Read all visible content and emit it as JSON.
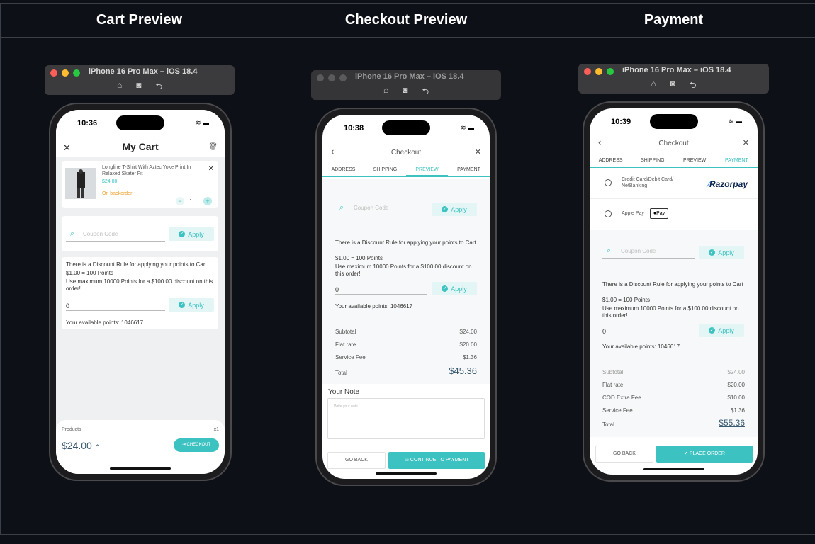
{
  "columns": [
    {
      "title": "Cart Preview"
    },
    {
      "title": "Checkout Preview"
    },
    {
      "title": "Payment"
    }
  ],
  "simulator": {
    "title": "iPhone 16 Pro Max – iOS 18.4",
    "icons": [
      "⌂",
      "◙",
      "⮌"
    ]
  },
  "cart": {
    "time": "10:36",
    "status_icons": "···· ≋ ▬",
    "title": "My Cart",
    "item": {
      "name": "Longline T-Shirt With Aztec Yoke Print In Relaxed Skater Fit",
      "price": "$24.00",
      "stock": "On backorder",
      "qty": "1",
      "minus": "−",
      "plus": "+"
    },
    "coupon_placeholder": "Coupon Code",
    "apply": "Apply",
    "points_rule": "There is a Discount Rule for applying your points to Cart",
    "points_rate": "$1.00 = 100 Points",
    "points_max": "Use maximum 10000 Points for a $100.00 discount on this order!",
    "points_value": "0",
    "available": "Your available points: 1046617",
    "footer_label": "Products",
    "footer_count": "x1",
    "footer_total": "$24.00",
    "checkout": "CHECKOUT"
  },
  "checkout": {
    "time": "10:38",
    "status_icons": "···· ≋ ▬",
    "title": "Checkout",
    "tabs": [
      "ADDRESS",
      "SHIPPING",
      "PREVIEW",
      "PAYMENT"
    ],
    "coupon_placeholder": "Coupon Code",
    "apply": "Apply",
    "points_rule": "There is a Discount Rule for applying your points to Cart",
    "points_rate": "$1.00 = 100 Points",
    "points_max": "Use maximum 10000 Points for a $100.00 discount on this order!",
    "points_value": "0",
    "available": "Your available points: 1046617",
    "subtotal_label": "Subtotal",
    "subtotal": "$24.00",
    "flat_label": "Flat rate",
    "flat": "$20.00",
    "fee_label": "Service Fee",
    "fee": "$1.36",
    "total_label": "Total",
    "total": "$45.36",
    "note_label": "Your Note",
    "note_placeholder": "Write your note",
    "go_back": "GO BACK",
    "continue": "CONTINUE TO PAYMENT"
  },
  "payment": {
    "time": "10:39",
    "status_icons": "≋ ▬",
    "title": "Checkout",
    "tabs": [
      "ADDRESS",
      "SHIPPING",
      "PREVIEW",
      "PAYMENT"
    ],
    "method1": "Credit Card/Debit Card/ NetBanking",
    "razorpay": "Razorpay",
    "method2": "Apple Pay",
    "applepay_badge": "Pay",
    "coupon_placeholder": "Coupon Code",
    "apply": "Apply",
    "points_rule": "There is a Discount Rule for applying your points to Cart",
    "points_rate": "$1.00 = 100 Points",
    "points_max": "Use maximum 10000 Points for a $100.00 discount on this order!",
    "points_value": "0",
    "available": "Your available points: 1046617",
    "subtotal_label": "Subtotal",
    "subtotal": "$24.00",
    "flat_label": "Flat rate",
    "flat": "$20.00",
    "cod_label": "COD Extra Fee",
    "cod": "$10.00",
    "fee_label": "Service Fee",
    "fee": "$1.36",
    "total_label": "Total",
    "total": "$55.36",
    "go_back": "GO BACK",
    "place_order": "PLACE ORDER"
  },
  "colors": {
    "accent": "#3cc2c0",
    "background": "#0d1017",
    "backorder": "#f0a030"
  }
}
